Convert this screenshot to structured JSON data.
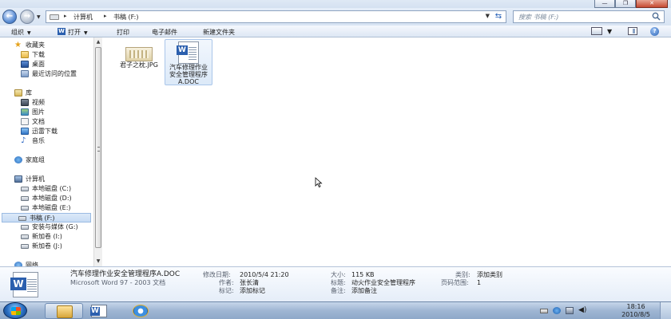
{
  "window": {
    "caption_buttons": {
      "minimize": "—",
      "maximize": "❐",
      "close": "✕"
    }
  },
  "address": {
    "crumbs": [
      "计算机",
      "书稿 (F:)"
    ],
    "separator": "▸",
    "search_placeholder": "搜索 书稿 (F:)"
  },
  "toolbar": {
    "organize": "组织",
    "open": "打开",
    "print": "打印",
    "email": "电子邮件",
    "new_folder": "新建文件夹",
    "dropdown_arrow": "▼"
  },
  "nav": {
    "favorites": "收藏夹",
    "downloads": "下载",
    "desktop": "桌面",
    "recent": "最近访问的位置",
    "libraries": "库",
    "videos": "视频",
    "pictures": "图片",
    "documents": "文档",
    "thunder": "迅雷下载",
    "music": "音乐",
    "homegroup": "家庭组",
    "computer": "计算机",
    "drive_c": "本地磁盘 (C:)",
    "drive_d": "本地磁盘 (D:)",
    "drive_e": "本地磁盘 (E:)",
    "drive_f": "书稿 (F:)",
    "drive_g": "安装与媒体 (G:)",
    "drive_i": "新加卷 (I:)",
    "drive_j": "新加卷 (J:)",
    "network": "网络"
  },
  "files": [
    {
      "name": "君子之枕.JPG",
      "type": "jpg",
      "selected": false
    },
    {
      "name": "汽车修理作业安全管理程序A.DOC",
      "type": "doc",
      "selected": true
    }
  ],
  "details": {
    "filename": "汽车修理作业安全管理程序A.DOC",
    "filetype": "Microsoft Word 97 - 2003 文档",
    "modified_label": "修改日期:",
    "modified_value": "2010/5/4 21:20",
    "author_label": "作者:",
    "author_value": "张长清",
    "tags_label": "标记:",
    "tags_value": "添加标记",
    "size_label": "大小:",
    "size_value": "115 KB",
    "title_label": "标题:",
    "title_value": "动火作业安全管理程序",
    "notes_label": "备注:",
    "notes_value": "添加备注",
    "category_label": "类别:",
    "category_value": "添加类别",
    "pages_label": "页码范围:",
    "pages_value": "1"
  },
  "taskbar": {
    "time": "18:16",
    "date": "2010/8/5"
  }
}
